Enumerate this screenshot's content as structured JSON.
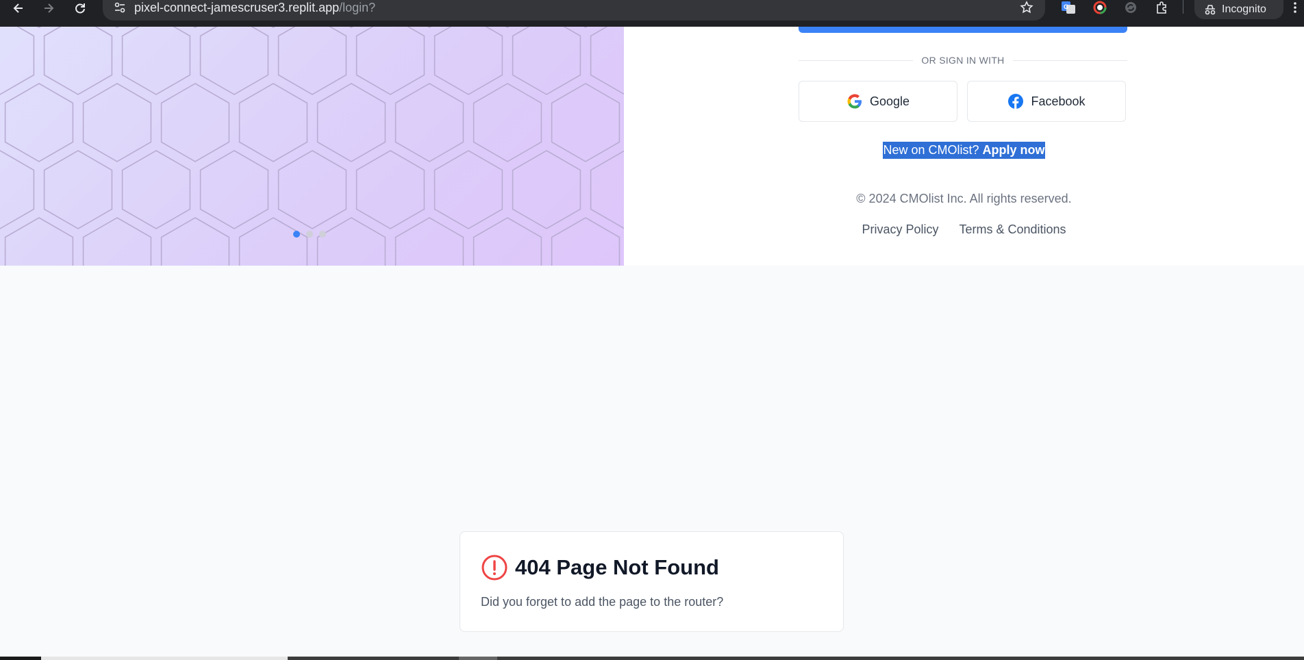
{
  "browser": {
    "url_host": "pixel-connect-jamescruser3.replit.app",
    "url_path": "/login?",
    "incognito_label": "Incognito"
  },
  "hero": {
    "carousel_dots": 3,
    "active_dot": 0,
    "gradient_colors": [
      "#e0e0fc",
      "#dec6fb"
    ]
  },
  "login": {
    "divider_text": "OR SIGN IN WITH",
    "google_label": "Google",
    "facebook_label": "Facebook",
    "new_on_text": "New on CMOlist?",
    "apply_link": "Apply now",
    "copyright": "© 2024 CMOlist Inc. All rights reserved.",
    "privacy_link": "Privacy Policy",
    "terms_link": "Terms & Conditions",
    "accent_color": "#3b82f6"
  },
  "not_found": {
    "title": "404 Page Not Found",
    "message": "Did you forget to add the page to the router?",
    "icon_color": "#ef4444"
  }
}
